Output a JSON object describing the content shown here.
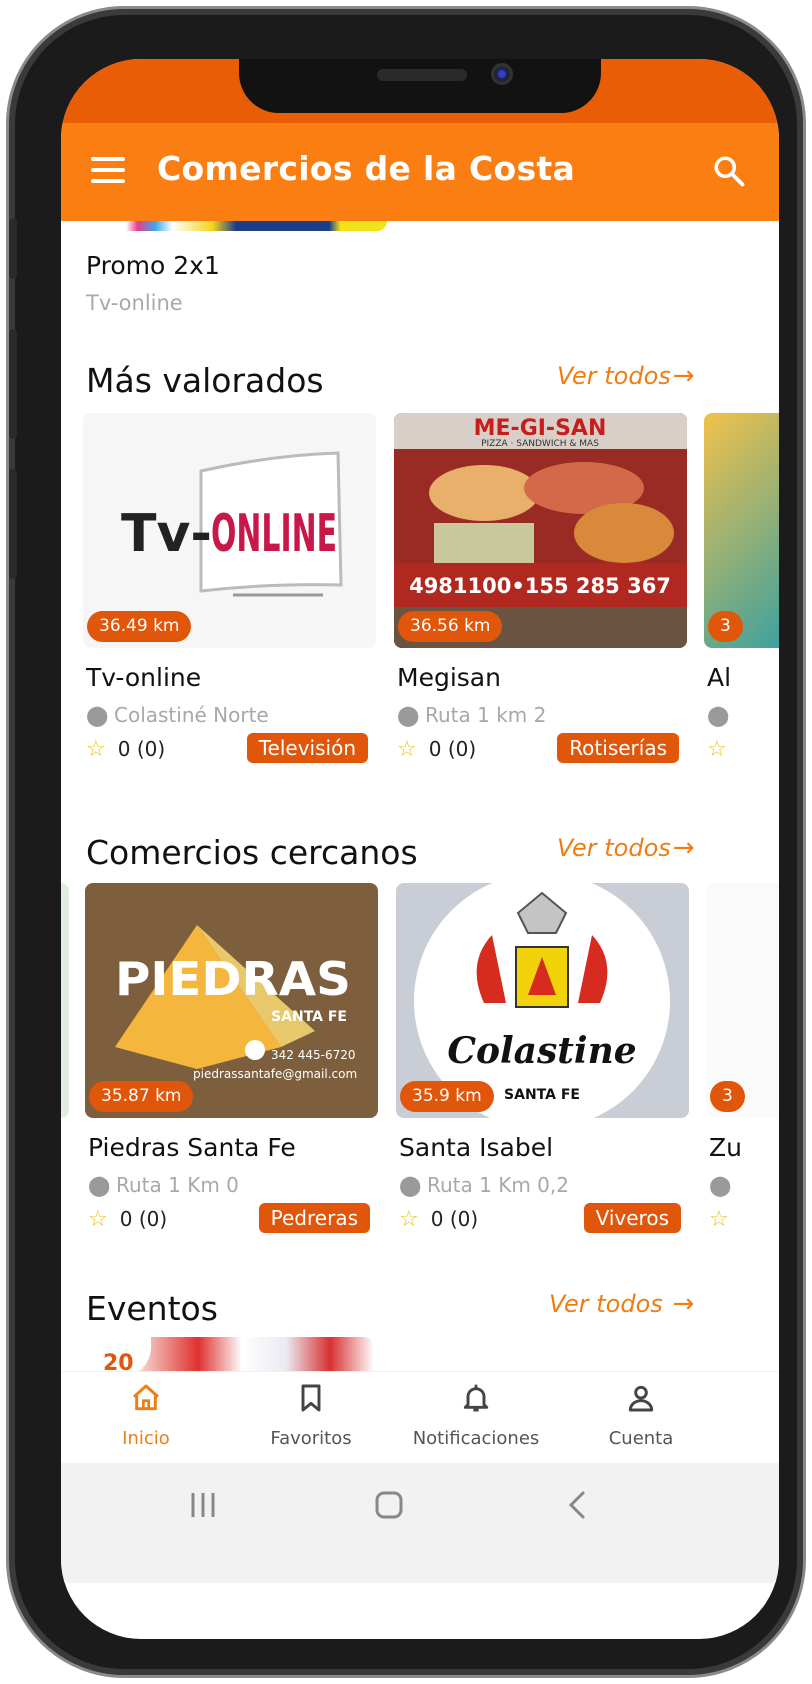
{
  "app_bar": {
    "title": "Comercios de la Costa"
  },
  "promo": {
    "title": "Promo 2x1",
    "subtitle": "Tv-online"
  },
  "top_rated": {
    "title": "Más valorados",
    "see_all": "Ver todos",
    "cards": [
      {
        "distance": "36.49 km",
        "name": "Tv-online",
        "location": "Colastiné Norte",
        "rating": "0 (0)",
        "category": "Televisión",
        "logo_text": "Tv-ONLINE"
      },
      {
        "distance": "36.56 km",
        "name": "Megisan",
        "location": "Ruta 1 km 2",
        "rating": "0 (0)",
        "category": "Rotiserías",
        "logo_text": "ME-GI-SAN",
        "logo_sub": "PIZZA · SANDWICH & MAS",
        "phone_text": "4981100•155 285 367"
      },
      {
        "distance": "3",
        "name": "Al"
      }
    ]
  },
  "nearby": {
    "title": "Comercios cercanos",
    "see_all": "Ver todos",
    "cards": [
      {
        "distance": "35.87 km",
        "name": "Piedras Santa Fe",
        "location": "Ruta 1 Km 0",
        "rating": "0 (0)",
        "category": "Pedreras",
        "logo_text": "PIEDRAS",
        "logo_sub": "SANTA FE",
        "phone_text": "342 445-6720",
        "email_text": "piedrassantafe@gmail.com"
      },
      {
        "distance": "35.9 km",
        "name": "Santa Isabel",
        "location": "Ruta 1 Km 0,2",
        "rating": "0 (0)",
        "category": "Viveros",
        "logo_text": "Colastine",
        "logo_sub": "SANTA FE"
      },
      {
        "distance": "3",
        "name": "Zu"
      }
    ]
  },
  "events": {
    "title": "Eventos",
    "see_all": "Ver todos",
    "badge": "20"
  },
  "bottom_nav": [
    {
      "label": "Inicio",
      "icon": "home-icon",
      "active": true
    },
    {
      "label": "Favoritos",
      "icon": "bookmark-icon",
      "active": false
    },
    {
      "label": "Notificaciones",
      "icon": "bell-icon",
      "active": false
    },
    {
      "label": "Cuenta",
      "icon": "person-icon",
      "active": false
    }
  ],
  "colors": {
    "primary": "#fa7e12",
    "status": "#e85d05",
    "badge": "#e0560a",
    "accent_text": "#f07d12"
  }
}
